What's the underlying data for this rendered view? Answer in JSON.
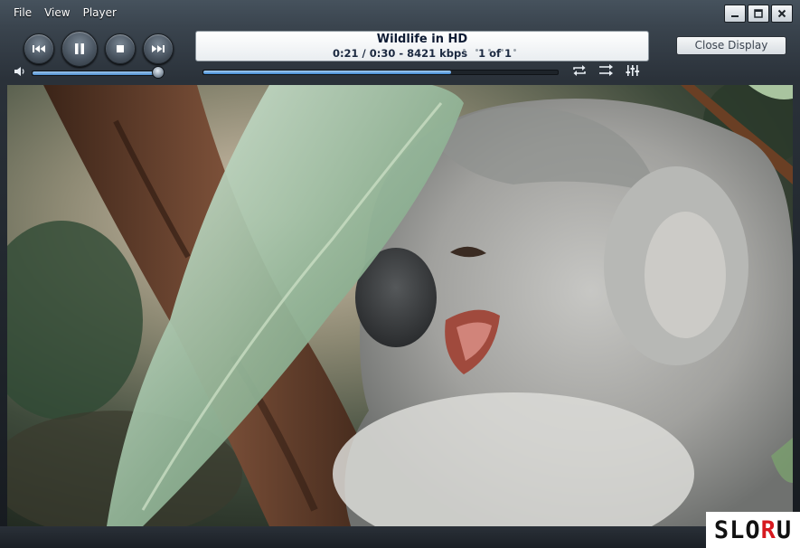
{
  "menu": [
    "File",
    "View",
    "Player"
  ],
  "window_controls": [
    "minimize-icon",
    "maximize-icon",
    "close-icon"
  ],
  "transport": {
    "buttons": [
      "previous-icon",
      "pause-icon",
      "stop-icon",
      "next-icon"
    ]
  },
  "display": {
    "title": "Wildlife in HD",
    "info": "0:21 / 0:30 - 8421 kbps   1 of 1"
  },
  "close_display_label": "Close Display",
  "volume": {
    "level": 0.95
  },
  "seek": {
    "position": 0.7,
    "elapsed": "0:21",
    "total": "0:30"
  },
  "right_icons": [
    "repeat-icon",
    "shuffle-icon",
    "equalizer-icon"
  ],
  "colors": {
    "accent": "#3d86d2",
    "display_text": "#0e1b33",
    "watermark_red": "#d6191f"
  },
  "watermark": {
    "part1": "SLO",
    "part2": "R",
    "part3": "U"
  }
}
